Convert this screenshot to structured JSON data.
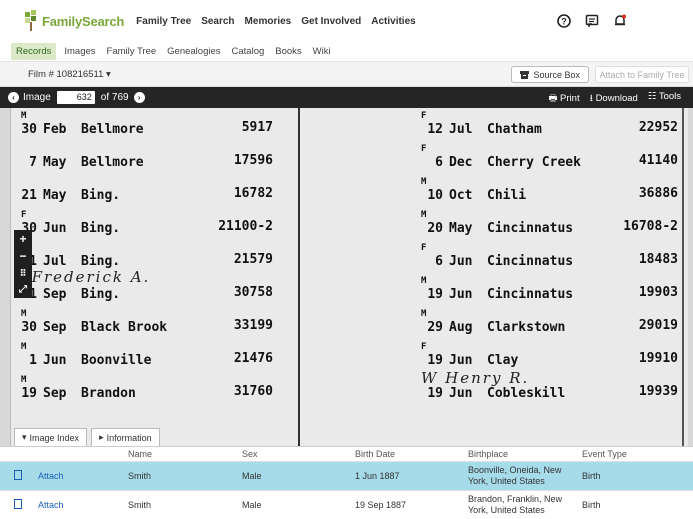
{
  "brand": {
    "name": "FamilySearch"
  },
  "mainnav": [
    "Family Tree",
    "Search",
    "Memories",
    "Get Involved",
    "Activities"
  ],
  "subnav": {
    "active": "Records",
    "items": [
      "Images",
      "Family Tree",
      "Genealogies",
      "Catalog",
      "Books",
      "Wiki"
    ]
  },
  "filmbar": {
    "film_label": "Film # 108216511 ▾",
    "source_box": "Source Box",
    "attach": "Attach to Family Tree"
  },
  "imagebar": {
    "image_label": "Image",
    "image_number": "632",
    "of_total": "of 769",
    "print": "Print",
    "download": "Download",
    "tools": "Tools"
  },
  "records_left": [
    {
      "mark": "M",
      "day": "30",
      "month": "Feb",
      "place": "Bellmore",
      "num": "5917"
    },
    {
      "mark": "",
      "day": "7",
      "month": "May",
      "place": "Bellmore",
      "num": "17596"
    },
    {
      "mark": "",
      "day": "21",
      "month": "May",
      "place": "Bing.",
      "num": "16782"
    },
    {
      "mark": "F",
      "day": "30",
      "month": "Jun",
      "place": "Bing.",
      "num": "21100-2"
    },
    {
      "mark": "F",
      "day": "1",
      "month": "Jul",
      "place": "Bing.",
      "num": "21579"
    },
    {
      "mark": "",
      "day": "11",
      "month": "Sep",
      "place": "Bing.",
      "num": "30758"
    },
    {
      "mark": "M",
      "day": "30",
      "month": "Sep",
      "place": "Black Brook",
      "num": "33199"
    },
    {
      "mark": "M",
      "day": "1",
      "month": "Jun",
      "place": "Boonville",
      "num": "21476"
    },
    {
      "mark": "M",
      "day": "19",
      "month": "Sep",
      "place": "Brandon",
      "num": "31760"
    }
  ],
  "records_right": [
    {
      "mark": "F",
      "day": "12",
      "month": "Jul",
      "place": "Chatham",
      "num": "22952"
    },
    {
      "mark": "F",
      "day": "6",
      "month": "Dec",
      "place": "Cherry Creek",
      "num": "41140"
    },
    {
      "mark": "M",
      "day": "10",
      "month": "Oct",
      "place": "Chili",
      "num": "36886"
    },
    {
      "mark": "M",
      "day": "20",
      "month": "May",
      "place": "Cincinnatus",
      "num": "16708-2"
    },
    {
      "mark": "F",
      "day": "6",
      "month": "Jun",
      "place": "Cincinnatus",
      "num": "18483"
    },
    {
      "mark": "M",
      "day": "19",
      "month": "Jun",
      "place": "Cincinnatus",
      "num": "19903"
    },
    {
      "mark": "M",
      "day": "29",
      "month": "Aug",
      "place": "Clarkstown",
      "num": "29019"
    },
    {
      "mark": "F",
      "day": "19",
      "month": "Jun",
      "place": "Clay",
      "num": "19910"
    },
    {
      "mark": "",
      "day": "19",
      "month": "Jun",
      "place": "Cobleskill",
      "num": "19939"
    }
  ],
  "handwriting": {
    "left": "+Frederick A.",
    "right": "W Henry R."
  },
  "tabs": {
    "image_index": "Image Index",
    "information": "Information"
  },
  "grid": {
    "headers": [
      "Name",
      "Sex",
      "Birth Date",
      "Birthplace",
      "Event Type"
    ],
    "rows": [
      {
        "action": "Attach",
        "name": "Smith",
        "sex": "Male",
        "birth_date": "1 Jun 1887",
        "birthplace": "Boonville, Oneida, New York, United States",
        "event": "Birth"
      },
      {
        "action": "Attach",
        "name": "Smith",
        "sex": "Male",
        "birth_date": "19 Sep 1887",
        "birthplace": "Brandon, Franklin, New York, United States",
        "event": "Birth"
      }
    ]
  },
  "colors": {
    "brand_green": "#7aa63a",
    "selected_row": "#a6dbe9",
    "link_blue": "#1a5fb4"
  }
}
